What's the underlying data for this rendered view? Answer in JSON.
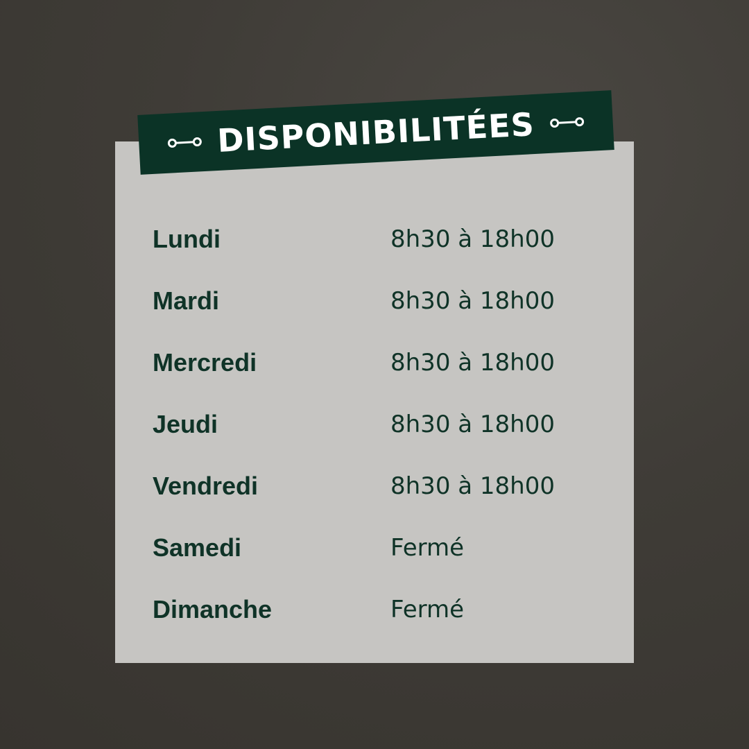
{
  "banner": {
    "title": "DISPONIBILITÉES",
    "left_icon": "connector-icon",
    "right_icon": "connector-icon"
  },
  "schedule": [
    {
      "day": "Lundi",
      "hours": "8h30 à 18h00"
    },
    {
      "day": "Mardi",
      "hours": "8h30 à 18h00"
    },
    {
      "day": "Mercredi",
      "hours": "8h30 à 18h00"
    },
    {
      "day": "Jeudi",
      "hours": "8h30 à 18h00"
    },
    {
      "day": "Vendredi",
      "hours": "8h30 à 18h00"
    },
    {
      "day": "Samedi",
      "hours": "Fermé"
    },
    {
      "day": "Dimanche",
      "hours": "Fermé"
    }
  ],
  "colors": {
    "background": "#3f3c37",
    "card": "#c6c5c2",
    "banner": "#0b3326",
    "text": "#0f3327",
    "banner_text": "#ffffff"
  }
}
